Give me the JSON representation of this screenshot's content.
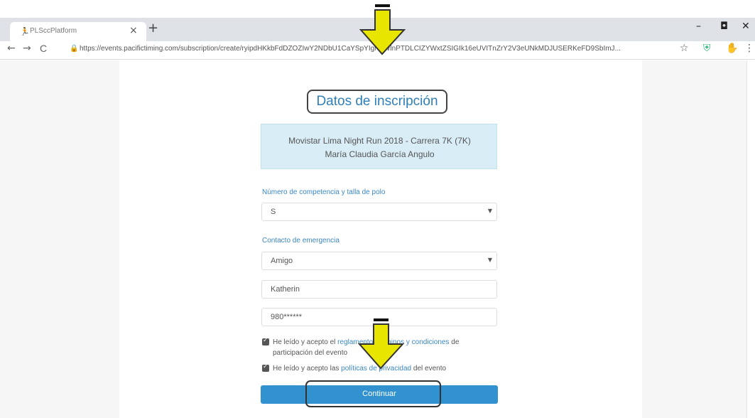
{
  "browser": {
    "tab_title": "PLSccPlatform",
    "tab_favicon": "runner-icon",
    "new_tab": "+",
    "window_controls": {
      "minimize": "–",
      "maximize": "◘",
      "close": "✕"
    },
    "nav": {
      "back": "←",
      "forward": "→",
      "reload": "C"
    },
    "url": "https://events.pacifictiming.com/subscription/create/ryipdHKkbFdDZOZIwY2NDbU1CaYSpYIgrWWlnPTDLCIZYWxtZSIGIk16eUVITnZrY2V3eUNkMDJUSERKeFD9SbImJ...",
    "toolbar_icons": [
      "star-icon",
      "shield-icon",
      "extension-icon",
      "menu-icon"
    ]
  },
  "form": {
    "title": "Datos de inscripción",
    "event_name": "Movistar Lima Night Run 2018 - Carrera 7K (7K)",
    "participant_name": "María Claudia García Angulo",
    "shirt_label": "Número de competencia y talla de polo",
    "shirt_value": "S",
    "emergency_label": "Contacto de emergencia",
    "relation_value": "Amigo",
    "contact_name_value": "Katherin",
    "contact_phone_value": "980******",
    "terms_text_1": "He leído y acepto el ",
    "terms_link": "reglamento, términos y condiciones",
    "terms_text_2": " de",
    "terms_text_3": "participación del evento",
    "privacy_text_1": "He leído y acepto las ",
    "privacy_link": "políticas de privacidad",
    "privacy_text_2": " del evento",
    "continue_label": "Continuar"
  },
  "colors": {
    "accent": "#3291cf",
    "title_text": "#2f7fb8",
    "event_box_bg": "#d9edf7",
    "annotation_arrow": "#e8e600"
  }
}
